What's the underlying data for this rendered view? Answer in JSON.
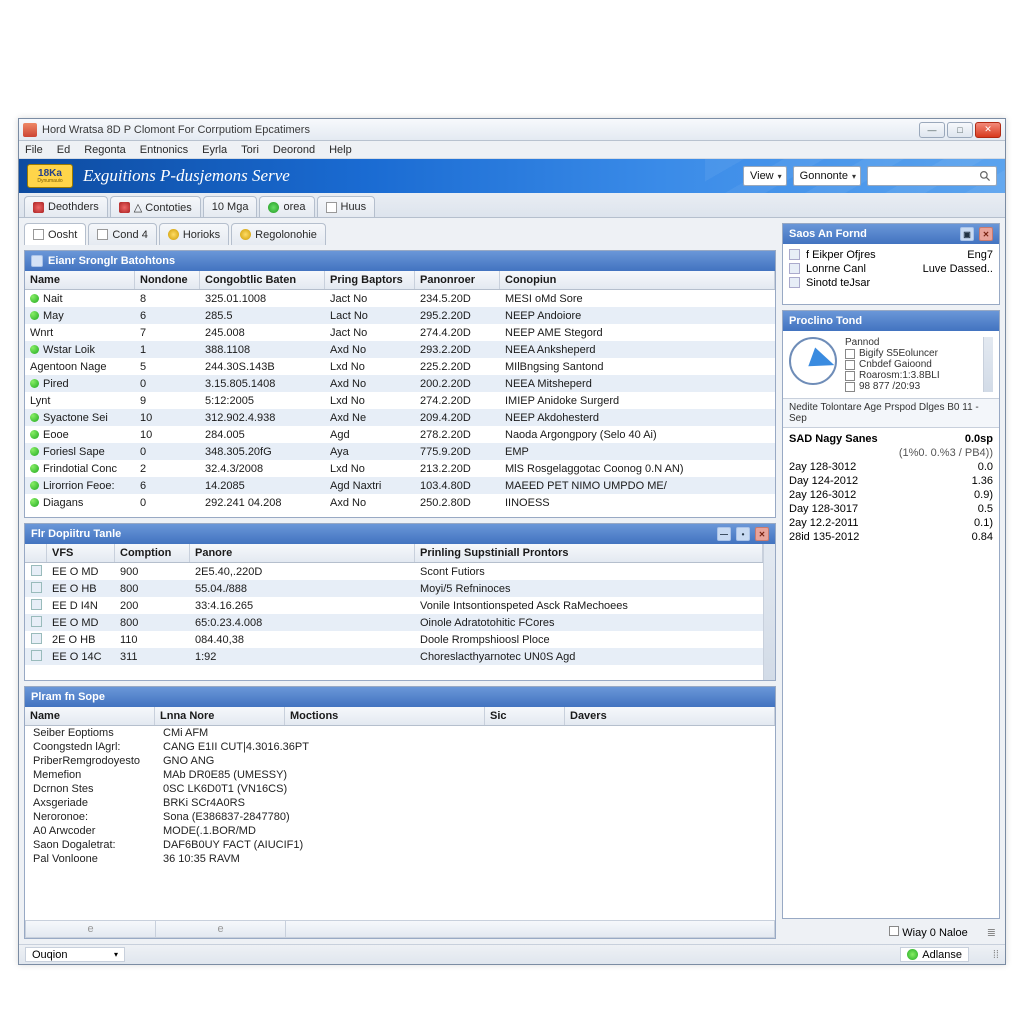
{
  "window": {
    "title": "Hord Wratsa 8D P Clomont For Corrputiom Epcatimers"
  },
  "menubar": [
    "File",
    "Ed",
    "Regonta",
    "Entnonics",
    "Eyrla",
    "Tori",
    "Deorond",
    "Help"
  ],
  "banner": {
    "logo_top": "18Ka",
    "logo_bottom": "Dynumauio",
    "title": "Exguitions P-dusjemons Serve",
    "view_label": "View",
    "gonnonte_label": "Gonnonte"
  },
  "main_tabs": [
    {
      "icon": "red",
      "label": "Deothders"
    },
    {
      "icon": "red",
      "label": "△ Contoties"
    },
    {
      "icon": "",
      "label": "10 Mga"
    },
    {
      "icon": "green",
      "label": "orea"
    },
    {
      "icon": "page",
      "label": "Huus"
    }
  ],
  "sub_tabs": [
    {
      "icon": "page",
      "label": "Oosht",
      "active": true
    },
    {
      "icon": "page",
      "label": "Cond 4"
    },
    {
      "icon": "yellow",
      "label": "Horioks"
    },
    {
      "icon": "yellow",
      "label": "Regolonohie"
    }
  ],
  "panel1": {
    "title": "Eianr Sronglr Batohtons",
    "cols": [
      "Name",
      "Nondone",
      "Congobtlic Baten",
      "Pring Baptors",
      "Panonroer",
      "Conopiun"
    ],
    "rows": [
      {
        "dot": true,
        "c": [
          "Nait",
          "8",
          "325.01.1008",
          "Jact No",
          "234.5.20D",
          "MESI oMd Sore"
        ]
      },
      {
        "dot": true,
        "c": [
          "May",
          "6",
          "285.5",
          "Lact No",
          "295.2.20D",
          "NEEP Andoiore"
        ]
      },
      {
        "dot": false,
        "c": [
          "Wnrt",
          "7",
          "245.008",
          "Jact No",
          "274.4.20D",
          "NEEP AME Stegord"
        ]
      },
      {
        "dot": true,
        "c": [
          "Wstar Loik",
          "1",
          "388.1108",
          "Axd No",
          "293.2.20D",
          "NEEA Anksheperd"
        ]
      },
      {
        "dot": false,
        "c": [
          "Agentoon Nage",
          "5",
          "244.30S.143B",
          "Lxd No",
          "225.2.20D",
          "MIlBngsing Santond"
        ]
      },
      {
        "dot": true,
        "c": [
          "Pired",
          "0",
          "3.15.805.1408",
          "Axd No",
          "200.2.20D",
          "NEEA Mitsheperd"
        ]
      },
      {
        "dot": false,
        "c": [
          "Lynt",
          "9",
          "5:12:2005",
          "Lxd No",
          "274.2.20D",
          "IMIEP Anidoke Surgerd"
        ]
      },
      {
        "dot": true,
        "c": [
          "Syactone Sei",
          "10",
          "312.902.4.938",
          "Axd Ne",
          "209.4.20D",
          "NEEP Akdohesterd"
        ]
      },
      {
        "dot": true,
        "c": [
          "Eooe",
          "10",
          "284.005",
          "Agd",
          "278.2.20D",
          "Naoda Argongpory (Selo 40 Ai)"
        ]
      },
      {
        "dot": true,
        "c": [
          "Foriesl Sape",
          "0",
          "348.305.20fG",
          "Aya",
          "775.9.20D",
          "EMP"
        ]
      },
      {
        "dot": true,
        "c": [
          "Frindotial Conc",
          "2",
          "32.4.3/2008",
          "Lxd No",
          "213.2.20D",
          "MlS Rosgelaggotac Coonog 0.N AN)"
        ]
      },
      {
        "dot": true,
        "c": [
          "Lirorrion Feoe:",
          "6",
          "14.2085",
          "Agd Naxtri",
          "103.4.80D",
          "MAEED PET NIMO UMPDO ME/"
        ]
      },
      {
        "dot": true,
        "c": [
          "Diagans",
          "0",
          "292.241 04.208",
          "Axd No",
          "250.2.80D",
          "IINOESS"
        ]
      }
    ]
  },
  "panel2": {
    "title": "Flr Dopiitru Tanle",
    "cols": [
      "",
      "VFS",
      "Comption",
      "Panore",
      "Prinling Supstiniall Prontors"
    ],
    "rows": [
      {
        "c": [
          "EE O MD",
          "900",
          "2E5.40,.220D",
          "Scont Futiors"
        ]
      },
      {
        "c": [
          "EE O HB",
          "800",
          "55.04./888",
          "Moyi/5 Refninoces"
        ]
      },
      {
        "c": [
          "EE D I4N",
          "200",
          "33:4.16.265",
          "Vonile Intsontionspeted Asck RaMechoees"
        ]
      },
      {
        "c": [
          "EE O MD",
          "800",
          "65:0.23.4.008",
          "Oinole Adratotohitic FCores"
        ]
      },
      {
        "c": [
          "2E O HB",
          "110",
          "084.40,38",
          "Doole Rrompshioosl Ploce"
        ]
      },
      {
        "c": [
          "EE O 14C",
          "311",
          "1:92",
          "Choreslacthyarnotec UN0S Agd"
        ]
      }
    ]
  },
  "panel3": {
    "title": "Plram fn Sope",
    "cols": [
      "Name",
      "Lnna Nore",
      "Moctions",
      "Sic",
      "Davers"
    ],
    "rows": [
      {
        "k": "Seiber Eoptioms",
        "v": "CMi AFM"
      },
      {
        "k": "Coongstedn lAgrl:",
        "v": "CANG E1II CUT|4.3016.36PT"
      },
      {
        "k": "PriberRemgrodoyesto",
        "v": "GNO ANG"
      },
      {
        "k": "Memefion",
        "v": "MAb DR0E85 (UMESSY)"
      },
      {
        "k": "Dcrnon Stes",
        "v": "0SC LK6D0T1 (VN16CS)"
      },
      {
        "k": "Axsgeriade",
        "v": "BRKi SCr4A0RS"
      },
      {
        "k": "Neroronoe:",
        "v": "Sona (E386837-2847780)"
      },
      {
        "k": "A0 Arwcoder",
        "v": "MODE(.1.BOR/MD"
      },
      {
        "k": "Saon Dogaletrat:",
        "v": "DAF6B0UY FACT (AIUCIF1)"
      },
      {
        "k": "Pal Vonloone",
        "v": "36 10:35 RAVM"
      }
    ]
  },
  "side_format": {
    "title": "Saos An Fornd",
    "rows": [
      {
        "a": "f Eikper Ofjres",
        "b": "Eng7"
      },
      {
        "a": "Lonrne Canl",
        "b": "Luve Dassed.."
      },
      {
        "a": "Sinotd teJsar",
        "b": ""
      }
    ]
  },
  "side_proc": {
    "title": "Proclino Tond",
    "lines": [
      "Pannod",
      "Bigify S5Eoluncer",
      "Cnbdef Gaioond",
      "Roarosm:1:3.8BLI",
      "98 877 /20:93"
    ],
    "sub": "Nedite Tolontare Age Prspod Dlges B0 11 - Sep"
  },
  "side_stats": {
    "head": {
      "a": "SAD Nagy Sanes",
      "b": "0.0sp"
    },
    "sub": "(1%0. 0.%3 / PB4))",
    "rows": [
      {
        "a": "2ay 128-3012",
        "b": "0.0"
      },
      {
        "a": "Day 124-2012",
        "b": "1.36"
      },
      {
        "a": "2ay 126-3012",
        "b": "0.9)"
      },
      {
        "a": "Day 128-3017",
        "b": "0.5"
      },
      {
        "a": "2ay 12.2-2011",
        "b": "0.1)"
      },
      {
        "a": "28id 135-2012",
        "b": "0.84"
      }
    ]
  },
  "side_foot_check": "Wiay 0 Naloe",
  "status": {
    "left": "Ouqion",
    "right": "Adlanse"
  }
}
